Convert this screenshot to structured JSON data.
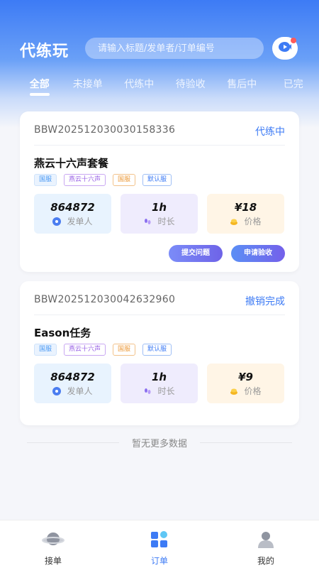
{
  "header": {
    "title": "代练玩",
    "search_placeholder": "请输入标题/发单者/订单编号"
  },
  "tabs": [
    {
      "label": "全部",
      "active": true
    },
    {
      "label": "未接单"
    },
    {
      "label": "代练中"
    },
    {
      "label": "待验收"
    },
    {
      "label": "售后中"
    },
    {
      "label": "已完"
    }
  ],
  "orders": [
    {
      "order_no": "BBW202512030030158336",
      "status": "代练中",
      "title": "燕云十六声套餐",
      "tags": [
        "国服",
        "燕云十六声",
        "国服",
        "默认服"
      ],
      "stats": {
        "publisher_id": "864872",
        "publisher_label": "发单人",
        "duration": "1h",
        "duration_label": "时长",
        "price": "¥18",
        "price_label": "价格"
      },
      "actions": [
        "提交问题",
        "申请验收"
      ]
    },
    {
      "order_no": "BBW202512030042632960",
      "status": "撤销完成",
      "title": "Eason任务",
      "tags": [
        "国服",
        "燕云十六声",
        "国服",
        "默认服"
      ],
      "stats": {
        "publisher_id": "864872",
        "publisher_label": "发单人",
        "duration": "1h",
        "duration_label": "时长",
        "price": "¥9",
        "price_label": "价格"
      },
      "actions": []
    }
  ],
  "footer_text": "暂无更多数据",
  "tabbar": [
    {
      "label": "接单",
      "icon": "planet-icon"
    },
    {
      "label": "订单",
      "icon": "order-grid-icon",
      "active": true
    },
    {
      "label": "我的",
      "icon": "user-icon"
    }
  ],
  "colors": {
    "brand": "#3d7bf5",
    "status_text": "#3d7bf5"
  }
}
